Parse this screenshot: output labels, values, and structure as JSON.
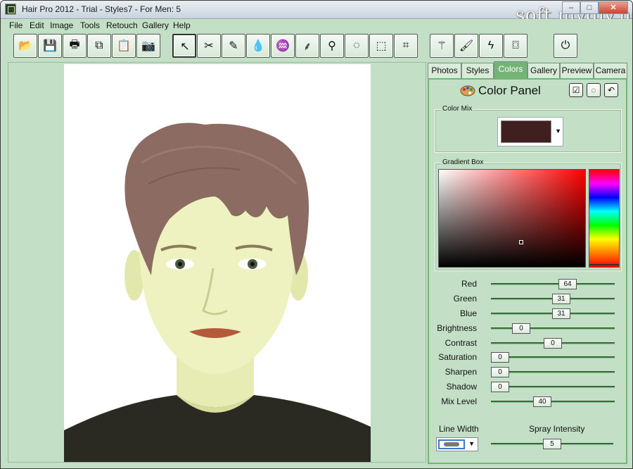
{
  "window": {
    "title": "Hair Pro 2012 - Trial - Styles7 - For Men: 5",
    "watermark": "soft.mydiv.net",
    "controls": {
      "minimize": "–",
      "maximize": "□",
      "close": "✕"
    }
  },
  "menu": {
    "items": [
      "File",
      "Edit",
      "Image",
      "Tools",
      "Retouch",
      "Gallery",
      "Help"
    ]
  },
  "toolbar": {
    "buttons": [
      {
        "name": "open-folder-icon",
        "glyph": "📂"
      },
      {
        "name": "save-icon",
        "glyph": "💾"
      },
      {
        "name": "print-icon",
        "glyph": "🖶"
      },
      {
        "name": "copy-icon",
        "glyph": "⧉"
      },
      {
        "name": "paste-icon",
        "glyph": "📋"
      },
      {
        "name": "camera-icon",
        "glyph": "📷"
      },
      {
        "name": "pointer-icon",
        "glyph": "↖"
      },
      {
        "name": "scissors-icon",
        "glyph": "✂"
      },
      {
        "name": "eyedropper-icon",
        "glyph": "✎"
      },
      {
        "name": "drop-icon",
        "glyph": "💧"
      },
      {
        "name": "hair-dryer-icon",
        "glyph": "♒"
      },
      {
        "name": "hair-strands-icon",
        "glyph": "⸙"
      },
      {
        "name": "spray-icon",
        "glyph": "⚲"
      },
      {
        "name": "lasso-icon",
        "glyph": "◌"
      },
      {
        "name": "rectangle-select-icon",
        "glyph": "⬚"
      },
      {
        "name": "crop-icon",
        "glyph": "⌗"
      },
      {
        "name": "magic-wand-icon",
        "glyph": "⚚"
      },
      {
        "name": "brush-icon",
        "glyph": "🖌"
      },
      {
        "name": "flash-icon",
        "glyph": "ϟ"
      },
      {
        "name": "tape-icon",
        "glyph": "⌼"
      },
      {
        "name": "power-icon",
        "glyph": "⏻"
      }
    ],
    "selected": "pointer-icon"
  },
  "tabs": [
    "Photos",
    "Styles",
    "Colors",
    "Gallery",
    "Preview",
    "Camera"
  ],
  "active_tab": "Colors",
  "panel": {
    "title": "Color Panel",
    "buttons": [
      {
        "name": "apply-check-icon",
        "glyph": "☑"
      },
      {
        "name": "lasso-select-icon",
        "glyph": "◌"
      },
      {
        "name": "undo-icon",
        "glyph": "↶"
      }
    ],
    "color_mix": {
      "label": "Color Mix",
      "current_color": "#401f1f"
    },
    "gradient_box": {
      "label": "Gradient Box",
      "hue_base": "#ff0000"
    },
    "sliders": [
      {
        "label": "Red",
        "value": "64",
        "fraction": 0.64
      },
      {
        "label": "Green",
        "value": "31",
        "fraction": 0.58
      },
      {
        "label": "Blue",
        "value": "31",
        "fraction": 0.58
      },
      {
        "label": "Brightness",
        "value": "0",
        "fraction": 0.2
      },
      {
        "label": "Contrast",
        "value": "0",
        "fraction": 0.5
      },
      {
        "label": "Saturation",
        "value": "0",
        "fraction": 0.0
      },
      {
        "label": "Sharpen",
        "value": "0",
        "fraction": 0.0
      },
      {
        "label": "Shadow",
        "value": "0",
        "fraction": 0.0
      },
      {
        "label": "Mix Level",
        "value": "40",
        "fraction": 0.4
      }
    ],
    "line_width_label": "Line Width",
    "spray_intensity": {
      "label": "Spray Intensity",
      "value": "5",
      "fraction": 0.5
    }
  },
  "colors": {
    "background": "#c3e0c6",
    "accent": "#74b477",
    "hair": "#8c6c62",
    "skin": "#eef2c0"
  }
}
